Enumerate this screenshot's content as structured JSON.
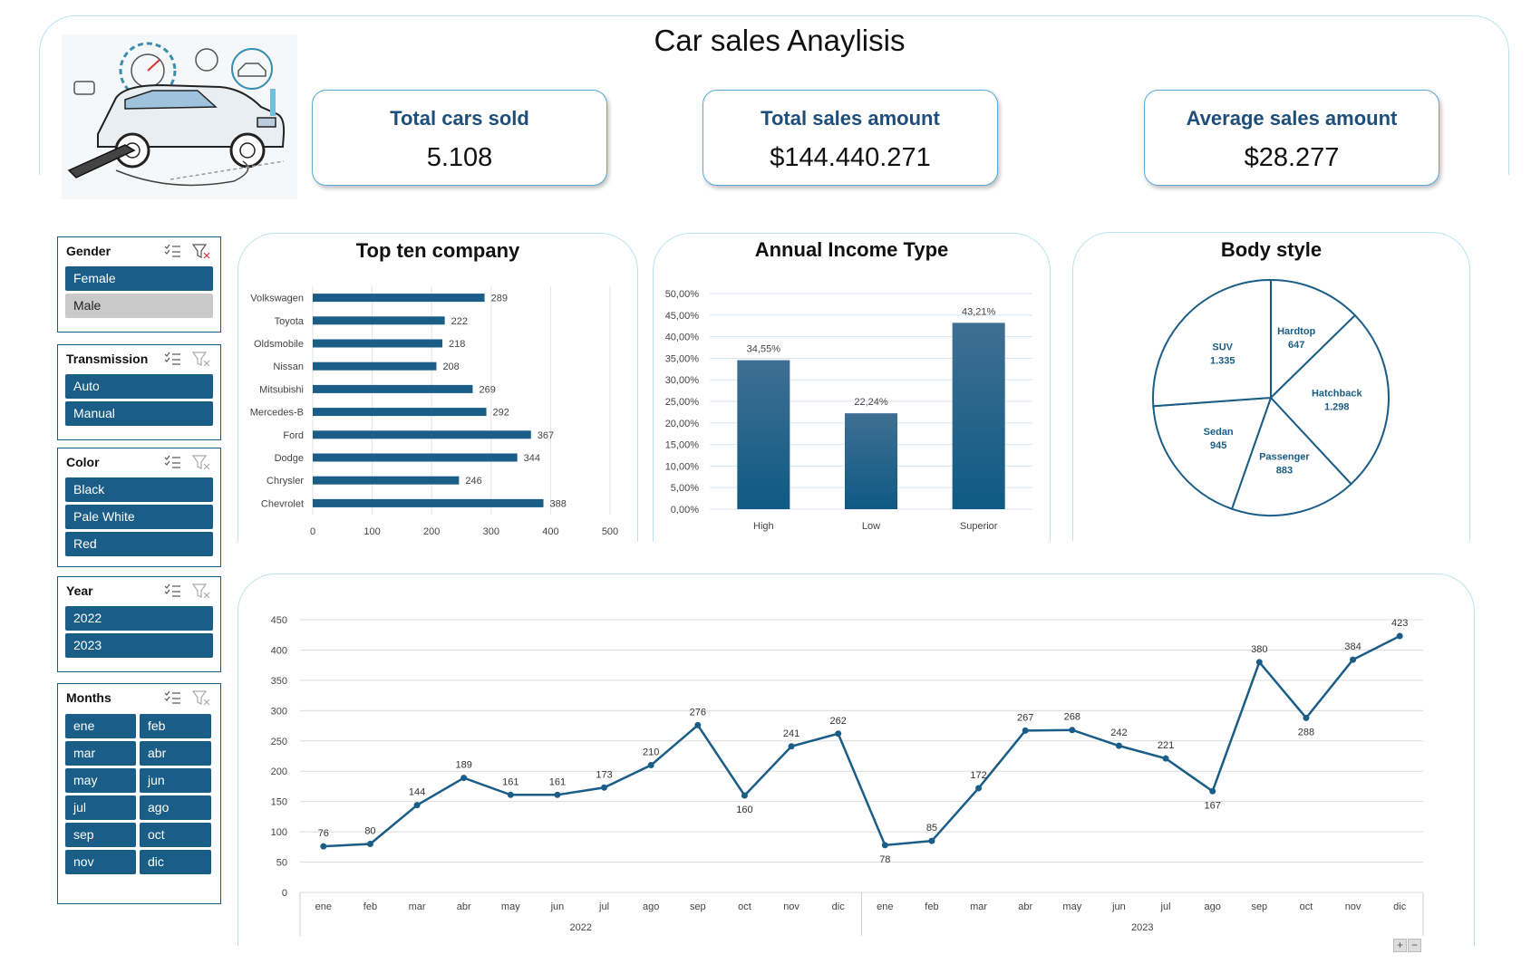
{
  "dashboard": {
    "title": "Car sales Anaylisis",
    "kpis": [
      {
        "title": "Total cars sold",
        "value": "5.108"
      },
      {
        "title": "Total sales amount",
        "value": "$144.440.271"
      },
      {
        "title": "Average sales amount",
        "value": "$28.277"
      }
    ]
  },
  "colors": {
    "accent": "#1a5d86",
    "panel_border": "#b9e3ef",
    "slicer_off": "#c9c9c9",
    "kpi_title": "#1f4e79"
  },
  "slicers": {
    "gender": {
      "title": "Gender",
      "items": [
        {
          "label": "Female",
          "selected": true
        },
        {
          "label": "Male",
          "selected": false
        }
      ]
    },
    "transmission": {
      "title": "Transmission",
      "items": [
        {
          "label": "Auto",
          "selected": true
        },
        {
          "label": "Manual",
          "selected": true
        }
      ]
    },
    "color": {
      "title": "Color",
      "items": [
        {
          "label": "Black",
          "selected": true
        },
        {
          "label": "Pale White",
          "selected": true
        },
        {
          "label": "Red",
          "selected": true
        }
      ]
    },
    "year": {
      "title": "Year",
      "items": [
        {
          "label": "2022",
          "selected": true
        },
        {
          "label": "2023",
          "selected": true
        }
      ]
    },
    "months": {
      "title": "Months",
      "items": [
        {
          "label": "ene"
        },
        {
          "label": "feb"
        },
        {
          "label": "mar"
        },
        {
          "label": "abr"
        },
        {
          "label": "may"
        },
        {
          "label": "jun"
        },
        {
          "label": "jul"
        },
        {
          "label": "ago"
        },
        {
          "label": "sep"
        },
        {
          "label": "oct"
        },
        {
          "label": "nov"
        },
        {
          "label": "dic"
        }
      ]
    }
  },
  "chart_data": [
    {
      "type": "bar",
      "orientation": "horizontal",
      "title": "Top ten company",
      "categories": [
        "Volkswagen",
        "Toyota",
        "Oldsmobile",
        "Nissan",
        "Mitsubishi",
        "Mercedes-B",
        "Ford",
        "Dodge",
        "Chrysler",
        "Chevrolet"
      ],
      "values": [
        289,
        222,
        218,
        208,
        269,
        292,
        367,
        344,
        246,
        388
      ],
      "xlim": [
        0,
        500
      ],
      "xticks": [
        "0",
        "100",
        "200",
        "300",
        "400",
        "500"
      ],
      "grid": true,
      "data_labels": true
    },
    {
      "type": "bar",
      "title": "Annual Income Type",
      "categories": [
        "High",
        "Low",
        "Superior"
      ],
      "values": [
        34.55,
        22.24,
        43.21
      ],
      "value_labels": [
        "34,55%",
        "22,24%",
        "43,21%"
      ],
      "ylim": [
        0,
        50
      ],
      "yticks": [
        "0,00%",
        "5,00%",
        "10,00%",
        "15,00%",
        "20,00%",
        "25,00%",
        "30,00%",
        "35,00%",
        "40,00%",
        "45,00%",
        "50,00%"
      ],
      "grid": true
    },
    {
      "type": "pie",
      "title": "Body style",
      "slices": [
        {
          "label": "Hardtop",
          "value": 647,
          "value_label": "647"
        },
        {
          "label": "Hatchback",
          "value": 1298,
          "value_label": "1.298"
        },
        {
          "label": "Passenger",
          "value": 883,
          "value_label": "883"
        },
        {
          "label": "Sedan",
          "value": 945,
          "value_label": "945"
        },
        {
          "label": "SUV",
          "value": 1335,
          "value_label": "1.335"
        }
      ]
    },
    {
      "type": "line",
      "title": "",
      "x_groups": [
        {
          "year": "2022",
          "months": [
            "ene",
            "feb",
            "mar",
            "abr",
            "may",
            "jun",
            "jul",
            "ago",
            "sep",
            "oct",
            "nov",
            "dic"
          ],
          "values": [
            76,
            80,
            144,
            189,
            161,
            161,
            173,
            210,
            276,
            160,
            241,
            262
          ]
        },
        {
          "year": "2023",
          "months": [
            "ene",
            "feb",
            "mar",
            "abr",
            "may",
            "jun",
            "jul",
            "ago",
            "sep",
            "oct",
            "nov",
            "dic"
          ],
          "values": [
            78,
            85,
            172,
            267,
            268,
            242,
            221,
            167,
            380,
            288,
            384,
            423
          ]
        }
      ],
      "ylim": [
        0,
        450
      ],
      "yticks": [
        "0",
        "50",
        "100",
        "150",
        "200",
        "250",
        "300",
        "350",
        "400",
        "450"
      ],
      "grid": true,
      "data_labels": true
    }
  ]
}
